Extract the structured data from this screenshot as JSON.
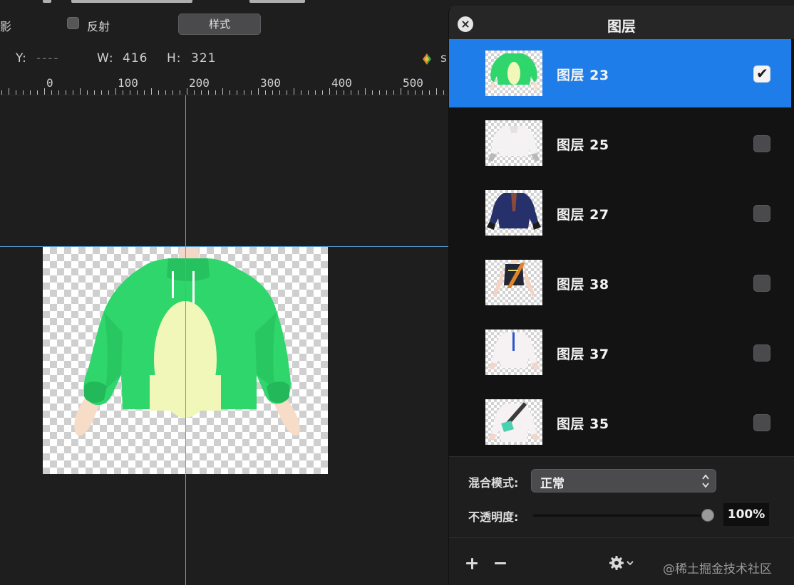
{
  "toolbar": {
    "shadow_label": "影",
    "reflect_label": "反射",
    "reflect_checked": false,
    "style_button": "样式"
  },
  "geometry_readout": {
    "y_label": "Y:",
    "y_value": "----",
    "w_label": "W:",
    "w_value": "416",
    "h_label": "H:",
    "h_value": "321",
    "s_label": "s"
  },
  "ruler": {
    "labels": [
      "0",
      "100",
      "200",
      "300",
      "400",
      "500"
    ]
  },
  "layers_panel": {
    "title": "图层",
    "layers": [
      {
        "name": "图层 23",
        "selected": true,
        "visible": true,
        "thumb": "green-hoodie"
      },
      {
        "name": "图层 25",
        "selected": false,
        "visible": false,
        "thumb": "white-top"
      },
      {
        "name": "图层 27",
        "selected": false,
        "visible": false,
        "thumb": "navy-blazer"
      },
      {
        "name": "图层 38",
        "selected": false,
        "visible": false,
        "thumb": "black-tank"
      },
      {
        "name": "图层 37",
        "selected": false,
        "visible": false,
        "thumb": "white-shirt"
      },
      {
        "name": "图层 35",
        "selected": false,
        "visible": false,
        "thumb": "white-shirt-with-bag"
      }
    ],
    "blend_mode_label": "混合模式:",
    "blend_mode_value": "正常",
    "opacity_label": "不透明度:",
    "opacity_value": "100%",
    "opacity_fraction": 1.0
  },
  "footer": {
    "add_icon": "plus-icon",
    "remove_icon": "minus-icon",
    "settings_icon": "gear-icon",
    "watermark": "@稀土掘金技术社区"
  },
  "colors": {
    "selected_row": "#1e7de8",
    "guide_line": "#5aa0d8",
    "hoodie_green": "#2fd66b",
    "hoodie_belly": "#f1f7b8"
  }
}
